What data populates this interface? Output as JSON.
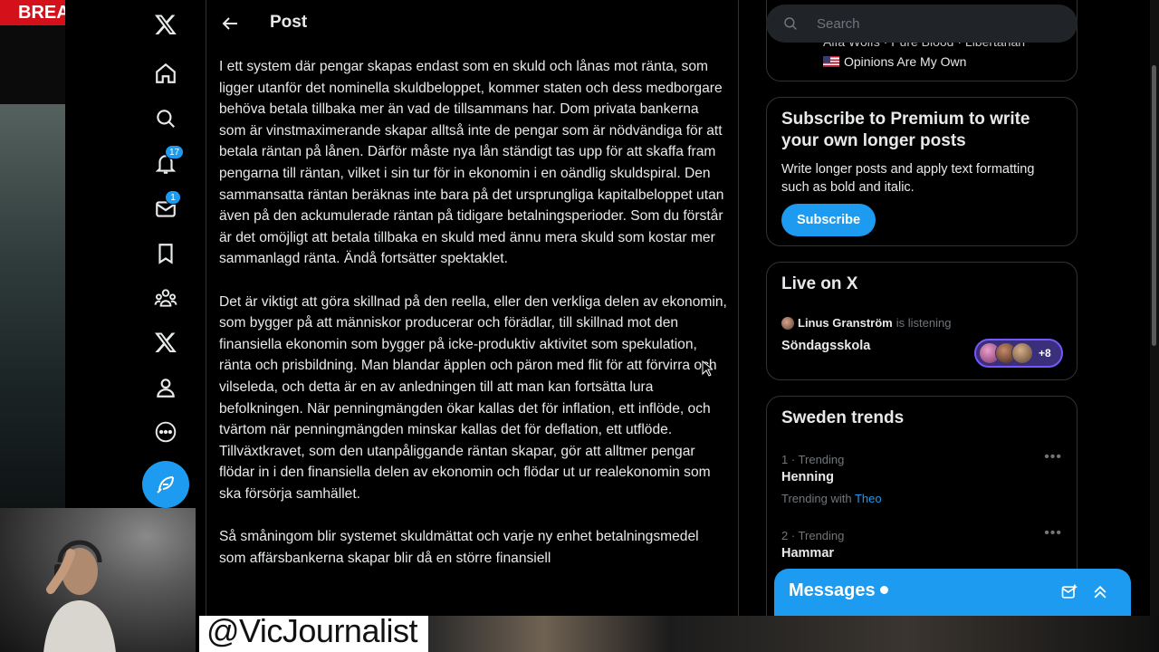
{
  "overlay": {
    "breaking_text": "BREA",
    "handle": "@VicJournalist"
  },
  "sidebar": {
    "items": [
      {
        "icon": "x-logo-icon"
      },
      {
        "icon": "home-icon"
      },
      {
        "icon": "search-icon"
      },
      {
        "icon": "bell-icon",
        "badge": "17"
      },
      {
        "icon": "mail-icon",
        "badge": "1"
      },
      {
        "icon": "bookmark-icon"
      },
      {
        "icon": "communities-icon"
      },
      {
        "icon": "x-premium-icon"
      },
      {
        "icon": "profile-icon"
      },
      {
        "icon": "more-icon"
      }
    ],
    "compose_icon": "feather-icon"
  },
  "main": {
    "title": "Post",
    "paragraphs": [
      "I ett system där pengar skapas endast som en skuld och lånas mot ränta, som ligger utanför det nominella skuldbeloppet, kommer staten och dess medborgare behöva betala tillbaka mer än vad de tillsammans har. Dom privata bankerna som är vinstmaximerande skapar alltså inte de pengar som är nödvändiga för att betala räntan på lånen. Därför måste nya lån ständigt tas upp för att skaffa fram pengarna till räntan, vilket i sin tur för in ekonomin i en oändlig skuldspiral. Den sammansatta räntan beräknas inte bara på det ursprungliga kapitalbeloppet utan även på den ackumulerade räntan på tidigare betalningsperioder. Som du förstår är det omöjligt att betala tillbaka en skuld med ännu mera skuld som kostar mer sammanlagd ränta. Ändå fortsätter spektaklet.",
      "Det är viktigt att göra skillnad på den reella, eller den verkliga delen av ekonomin, som bygger på att människor producerar och förädlar, till skillnad mot den finansiella ekonomin som bygger på icke-produktiv aktivitet som spekulation, ränta och prisbildning. Man blandar äpplen och päron med flit för att förvirra och vilseleda, och detta är en av anledningen till att man kan fortsätta lura befolkningen. När penningmängden ökar kallas det för inflation, ett inflöde, och tvärtom när penningmängden minskar kallas det för deflation, ett utflöde. Tillväxtkravet, som den utanpåliggande räntan skapar, gör att alltmer pengar flödar in i den finansiella delen av ekonomin och flödar ut ur realekonomin som ska försörja samhället.",
      "Så småningom blir systemet skuldmättat och varje ny enhet betalningsmedel som affärsbankerna skapar blir då en större finansiell"
    ]
  },
  "right": {
    "search_placeholder": "Search",
    "profile_snippet": {
      "line1": "Alfa Wolfs · Pure Blood · Libertarian",
      "line2": "Opinions Are My Own"
    },
    "premium": {
      "title": "Subscribe to Premium to write your own longer posts",
      "description": "Write longer posts and apply text formatting such as bold and italic.",
      "button": "Subscribe"
    },
    "live": {
      "title": "Live on X",
      "host": "Linus Granström",
      "status": "is listening",
      "space_title": "Söndagsskola",
      "more_count": "+8"
    },
    "trends": {
      "title": "Sweden trends",
      "items": [
        {
          "meta": "1 · Trending",
          "name": "Henning",
          "with_label": "Trending with",
          "with_link": "Theo"
        },
        {
          "meta": "2 · Trending",
          "name": "Hammar"
        }
      ]
    },
    "messages": {
      "title": "Messages"
    }
  },
  "colors": {
    "accent": "#1d9bf0",
    "breaking_red": "#d4111b",
    "spaces_purple": "#7856ff"
  }
}
